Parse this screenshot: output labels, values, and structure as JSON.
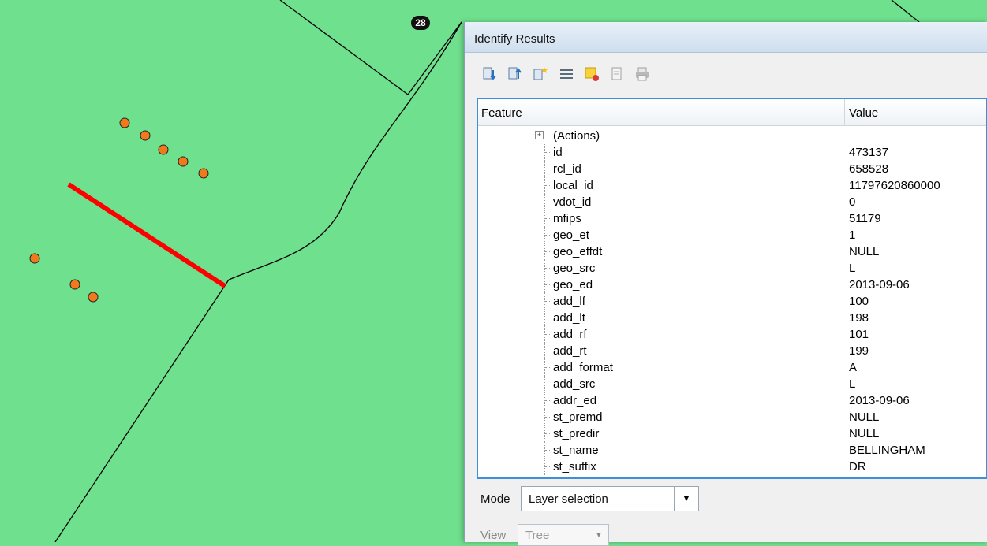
{
  "map": {
    "label_badge": "28",
    "colors": {
      "background": "#6fe08e",
      "point_fill": "#f07a1b",
      "selected_line": "#ff0000"
    }
  },
  "panel": {
    "title": "Identify Results",
    "toolbar_icons": [
      "expand-all-icon",
      "collapse-all-icon",
      "expand-new-icon",
      "open-form-icon",
      "clear-highlight-icon",
      "copy-icon",
      "print-icon"
    ],
    "columns": {
      "feature": "Feature",
      "value": "Value"
    },
    "actions_label": "(Actions)",
    "rows": [
      {
        "name": "id",
        "value": "473137"
      },
      {
        "name": "rcl_id",
        "value": "658528"
      },
      {
        "name": "local_id",
        "value": "11797620860000"
      },
      {
        "name": "vdot_id",
        "value": "0"
      },
      {
        "name": "mfips",
        "value": "51179"
      },
      {
        "name": "geo_et",
        "value": "1"
      },
      {
        "name": "geo_effdt",
        "value": "NULL"
      },
      {
        "name": "geo_src",
        "value": "L"
      },
      {
        "name": "geo_ed",
        "value": "2013-09-06"
      },
      {
        "name": "add_lf",
        "value": "100"
      },
      {
        "name": "add_lt",
        "value": "198"
      },
      {
        "name": "add_rf",
        "value": "101"
      },
      {
        "name": "add_rt",
        "value": "199"
      },
      {
        "name": "add_format",
        "value": "A"
      },
      {
        "name": "add_src",
        "value": "L"
      },
      {
        "name": "addr_ed",
        "value": "2013-09-06"
      },
      {
        "name": "st_premd",
        "value": "NULL"
      },
      {
        "name": "st_predir",
        "value": "NULL"
      },
      {
        "name": "st_name",
        "value": "BELLINGHAM"
      },
      {
        "name": "st_suffix",
        "value": "DR"
      }
    ],
    "mode": {
      "label": "Mode",
      "value": "Layer selection"
    },
    "view": {
      "label": "View",
      "value": "Tree"
    }
  }
}
